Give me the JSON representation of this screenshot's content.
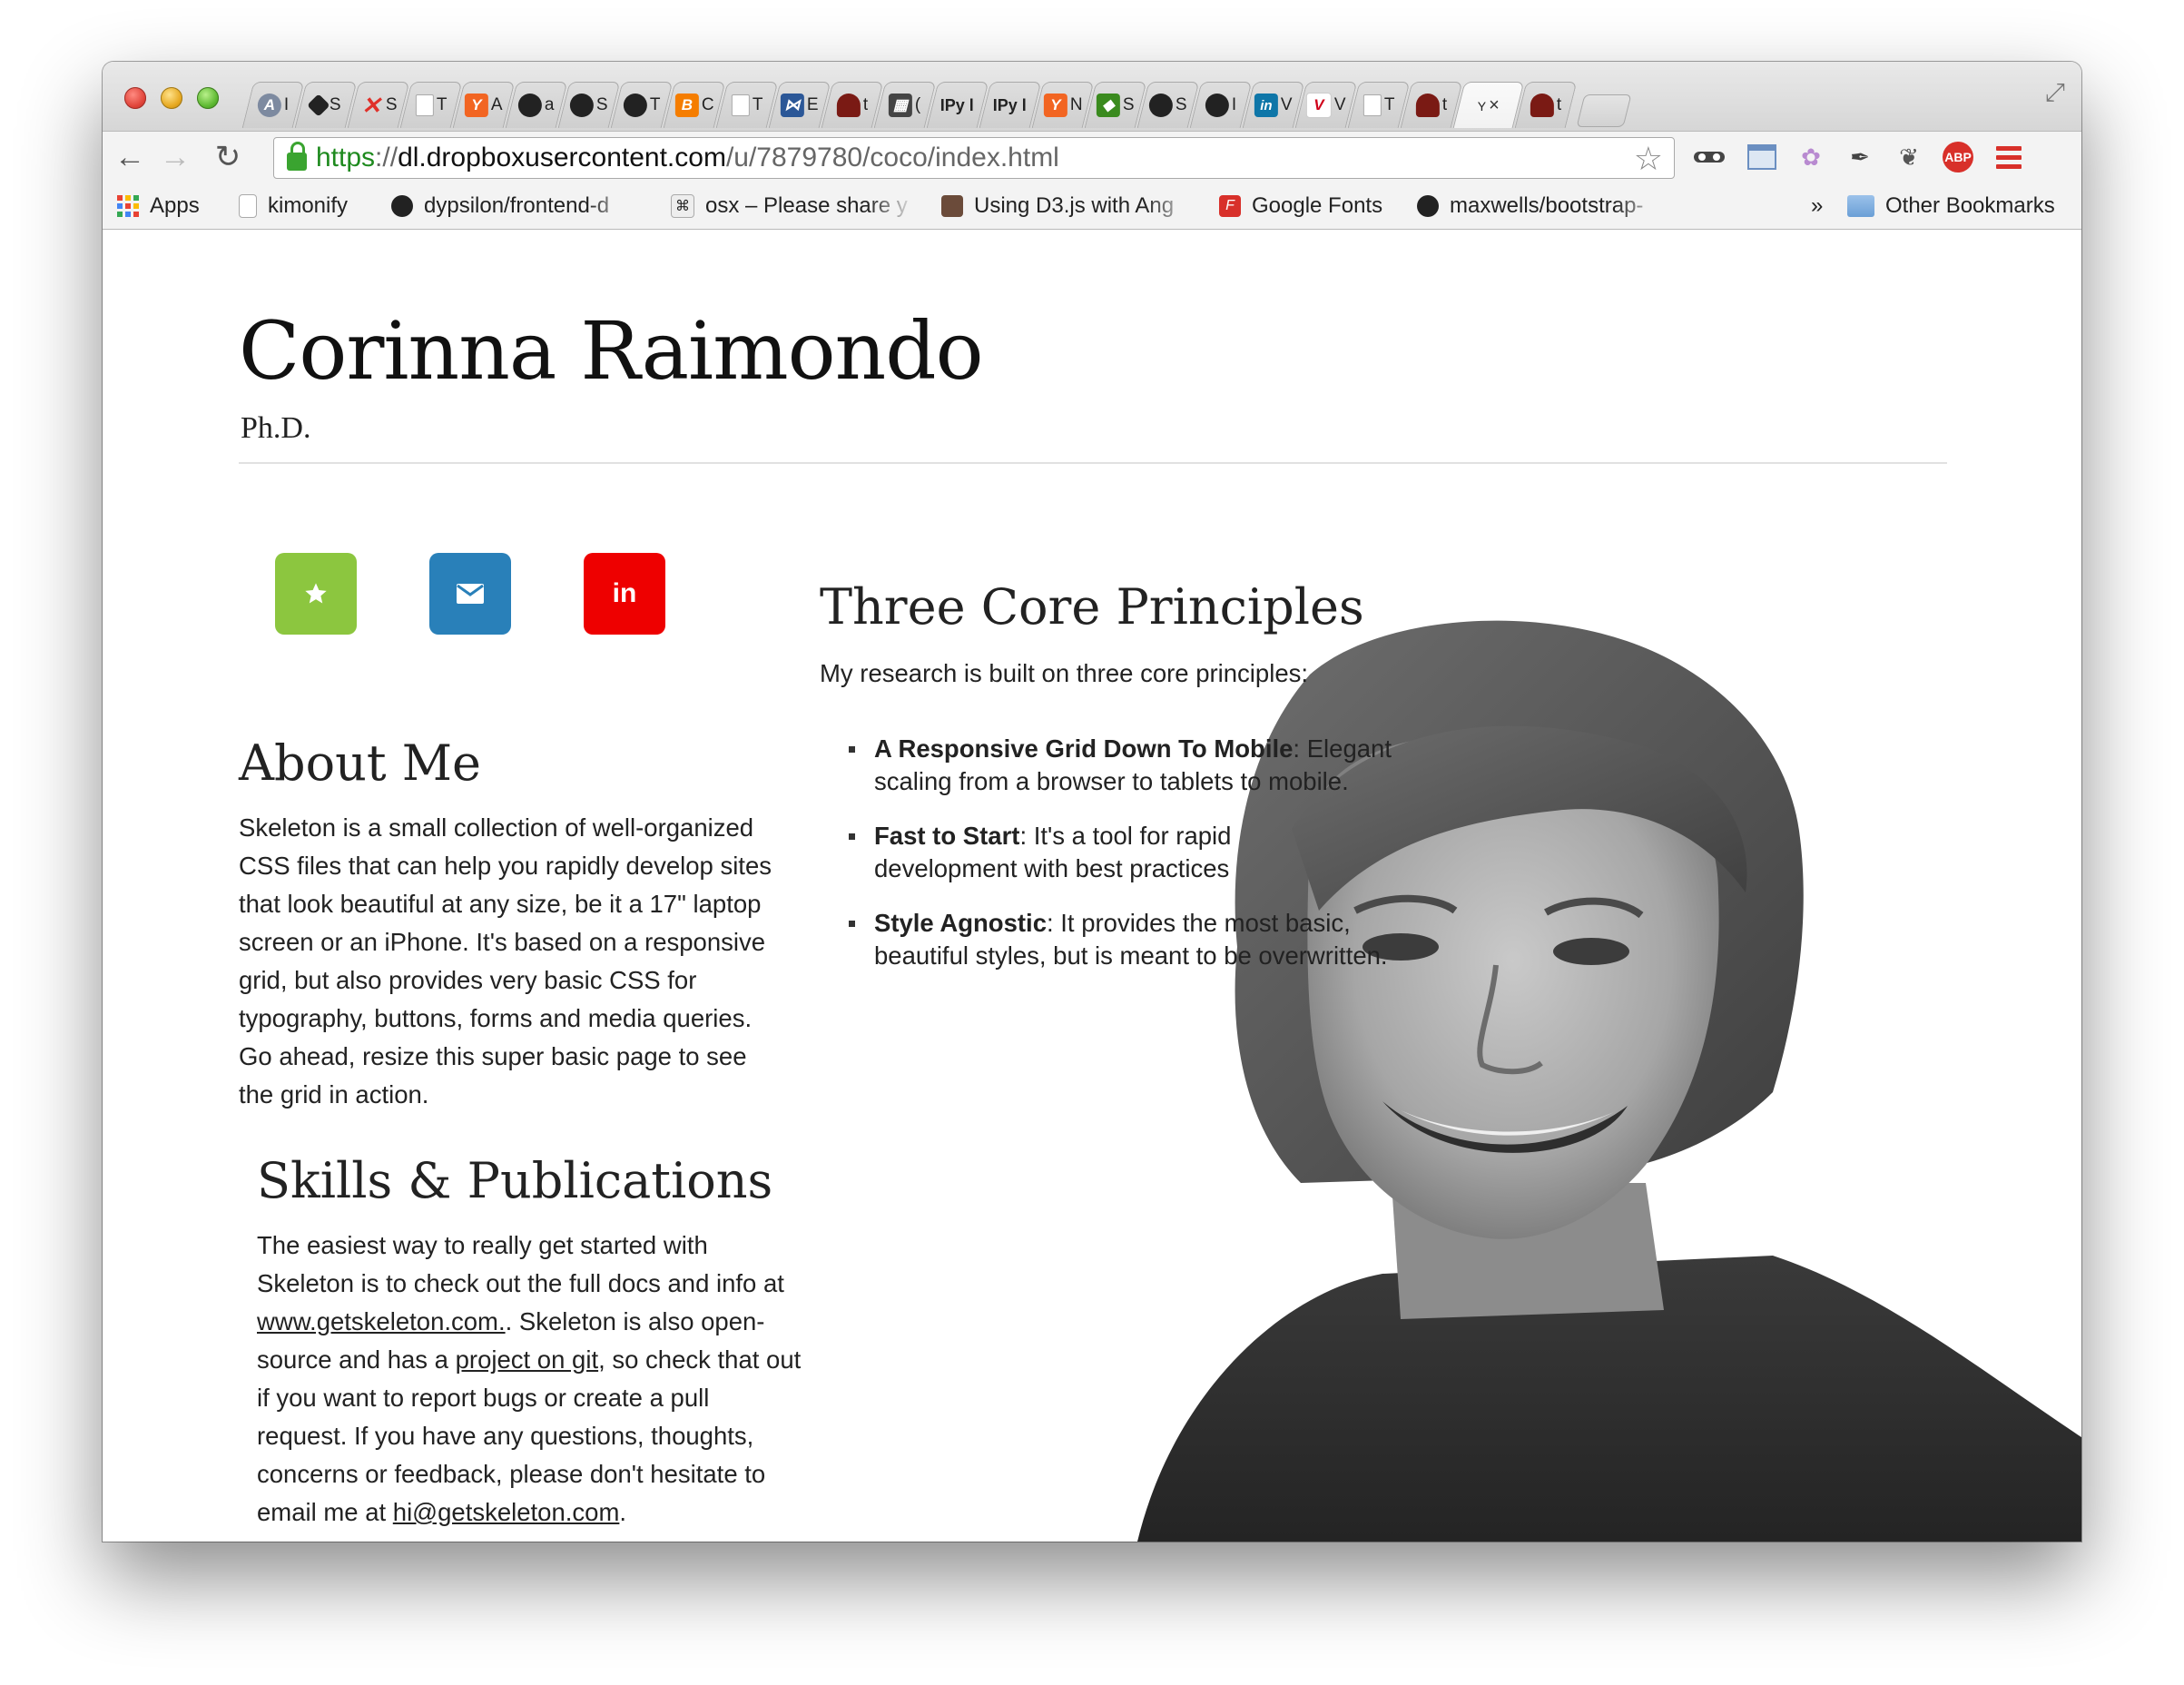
{
  "browser": {
    "url_scheme": "https",
    "url_separator": "://",
    "url_host": "dl.dropboxusercontent.com",
    "url_path": "/u/7879780/coco/index.html",
    "tabs": [
      {
        "icon": "a-icon",
        "text": "I"
      },
      {
        "icon": "diamond-icon",
        "text": "S"
      },
      {
        "icon": "red-x-icon",
        "text": "S"
      },
      {
        "icon": "page-icon",
        "text": "T"
      },
      {
        "icon": "hn-icon",
        "text": "A"
      },
      {
        "icon": "github-icon",
        "text": "a"
      },
      {
        "icon": "github-icon",
        "text": "S"
      },
      {
        "icon": "github-icon",
        "text": "T"
      },
      {
        "icon": "blogger-icon",
        "text": "C"
      },
      {
        "icon": "page-icon",
        "text": "T"
      },
      {
        "icon": "visualstudio-icon",
        "text": "E"
      },
      {
        "icon": "hat-icon",
        "text": "t"
      },
      {
        "icon": "grid-icon",
        "text": "("
      },
      {
        "icon": "ipy-icon",
        "text": "IPy l"
      },
      {
        "icon": "ipy-icon",
        "text": "IPy l"
      },
      {
        "icon": "hn-icon",
        "text": "N"
      },
      {
        "icon": "cube-icon",
        "text": "S"
      },
      {
        "icon": "github-icon",
        "text": "S"
      },
      {
        "icon": "github-icon",
        "text": "I"
      },
      {
        "icon": "linkedin-icon",
        "text": "V"
      },
      {
        "icon": "v-icon",
        "text": "V"
      },
      {
        "icon": "page-icon",
        "text": "T"
      },
      {
        "icon": "hat-icon",
        "text": "t"
      },
      {
        "icon": "active-icon",
        "text": "Y"
      },
      {
        "icon": "hat-icon",
        "text": "t"
      }
    ],
    "active_tab_close": "×",
    "bookmarks": [
      {
        "label": "Apps"
      },
      {
        "label": "kimonify"
      },
      {
        "label": "dypsilon/frontend-d"
      },
      {
        "label": "osx – Please share y"
      },
      {
        "label": "Using D3.js with Ang"
      },
      {
        "label": "Google Fonts"
      },
      {
        "label": "maxwells/bootstrap-"
      }
    ],
    "bookmarks_overflow": "»",
    "other_bookmarks": "Other Bookmarks",
    "abp_label": "ABP"
  },
  "page": {
    "name": "Corinna Raimondo",
    "degree": "Ph.D.",
    "social": [
      {
        "icon": "star-icon",
        "color": "#8cc63f"
      },
      {
        "icon": "envelope-icon",
        "color": "#2980b9"
      },
      {
        "icon": "linkedin-icon",
        "color": "#ee0000",
        "text": "in"
      }
    ],
    "about": {
      "title": "About Me",
      "text": "Skeleton is a small collection of well-organized CSS files that can help you rapidly develop sites that look beautiful at any size, be it a 17\" laptop screen or an iPhone. It's based on a responsive grid, but also provides very basic CSS for typography, buttons, forms and media queries. Go ahead, resize this super basic page to see the grid in action."
    },
    "skills": {
      "title": "Skills & Publications",
      "text_1": "The easiest way to really get started with Skeleton is to check out the full docs and info at ",
      "link_1": "www.getskeleton.com.",
      "text_2": ". Skeleton is also open-source and has a ",
      "link_2": "project on git",
      "text_3": ", so check that out if you want to report bugs or create a pull request. If you have any questions, thoughts, concerns or feedback, please don't hesitate to email me at ",
      "link_3": "hi@getskeleton.com",
      "text_4": "."
    },
    "principles": {
      "title": "Three Core Principles",
      "intro": "My research is built on three core principles:",
      "items": [
        {
          "bold": "A Responsive Grid Down To Mobile",
          "rest": ": Elegant scaling from a browser to tablets to mobile."
        },
        {
          "bold": "Fast to Start",
          "rest": ": It's a tool for rapid development with best practices"
        },
        {
          "bold": "Style Agnostic",
          "rest": ": It provides the most basic, beautiful styles, but is meant to be overwritten."
        }
      ]
    }
  }
}
